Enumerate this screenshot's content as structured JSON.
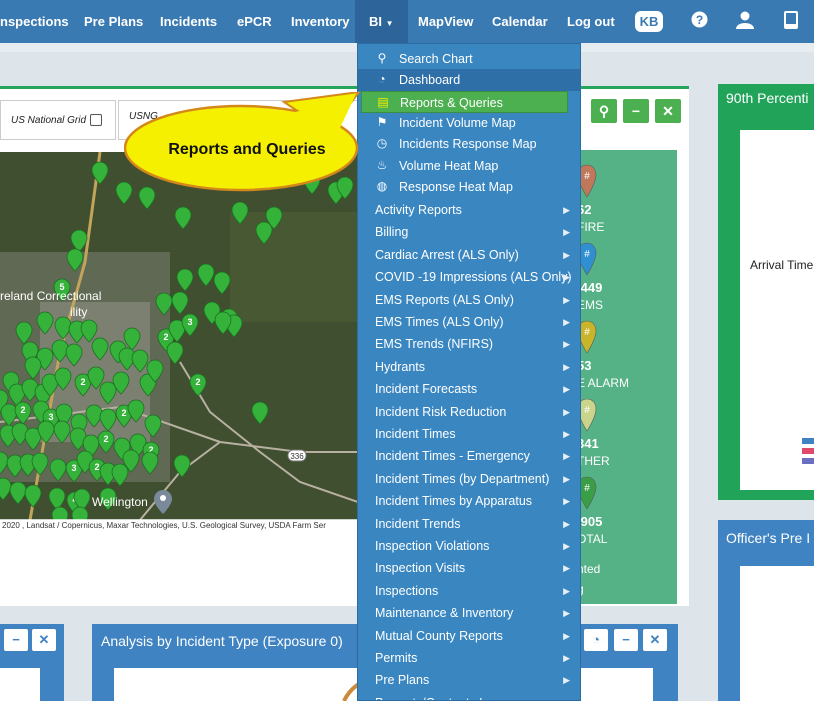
{
  "nav": {
    "items": [
      "nspections",
      "Pre Plans",
      "Incidents",
      "ePCR",
      "Inventory",
      "BI",
      "MapView",
      "Calendar",
      "Log out"
    ],
    "user_badge": "KB"
  },
  "toolbar": {
    "grid_label": "US National Grid",
    "usng_label": "USNG"
  },
  "map": {
    "place_label_1": "reland Correctional",
    "place_label_2": "ility",
    "town_label": "Wellington",
    "route_label": "336",
    "attribution": "2020 , Landsat / Copernicus, Maxar Technologies, U.S. Geological Survey, USDA Farm Ser"
  },
  "stats": [
    {
      "num": "62",
      "label": "FIRE",
      "color": "#c0785a"
    },
    {
      "num": ",449",
      "label": "EMS",
      "color": "#2f8fd0"
    },
    {
      "num": "53",
      "label": "E ALARM",
      "color": "#c9b52a"
    },
    {
      "num": "341",
      "label": "THER",
      "color": "#c9d58a"
    },
    {
      "num": ",905",
      "label": "OTAL",
      "color": "#3a9e46"
    }
  ],
  "stats_footer_1": "nted",
  "stats_footer_2": "g",
  "panels": {
    "percentile_title": "90th Percenti",
    "arrival_label": "Arrival Time",
    "officer_title": "Officer's Pre I",
    "analysis_title": "Analysis by Incident Type (Exposure 0)"
  },
  "callout": {
    "text": "Reports and Queries"
  },
  "dropdown": {
    "icon_items": [
      {
        "label": "Search Chart",
        "icon": "search-icon"
      },
      {
        "label": "Dashboard",
        "icon": "dashboard-icon"
      },
      {
        "label": "Reports & Queries",
        "icon": "reports-icon"
      },
      {
        "label": "Incident Volume Map",
        "icon": "map-marker-icon"
      },
      {
        "label": "Incidents Response Map",
        "icon": "clock-icon"
      },
      {
        "label": "Volume Heat Map",
        "icon": "fire-icon"
      },
      {
        "label": "Response Heat Map",
        "icon": "globe-icon"
      }
    ],
    "submenus": [
      "Activity Reports",
      "Billing",
      "Cardiac Arrest (ALS Only)",
      "COVID -19 Impressions (ALS Only)",
      "EMS Reports (ALS Only)",
      "EMS Times (ALS Only)",
      "EMS Trends (NFIRS)",
      "Hydrants",
      "Incident Forecasts",
      "Incident Risk Reduction",
      "Incident Times",
      "Incident Times - Emergency",
      "Incident Times (by Department)",
      "Incident Times by Apparatus",
      "Incident Trends",
      "Inspection Violations",
      "Inspection Visits",
      "Inspections",
      "Maintenance & Inventory",
      "Mutual County Reports",
      "Permits",
      "Pre Plans",
      "Property/Contents Loss"
    ]
  }
}
